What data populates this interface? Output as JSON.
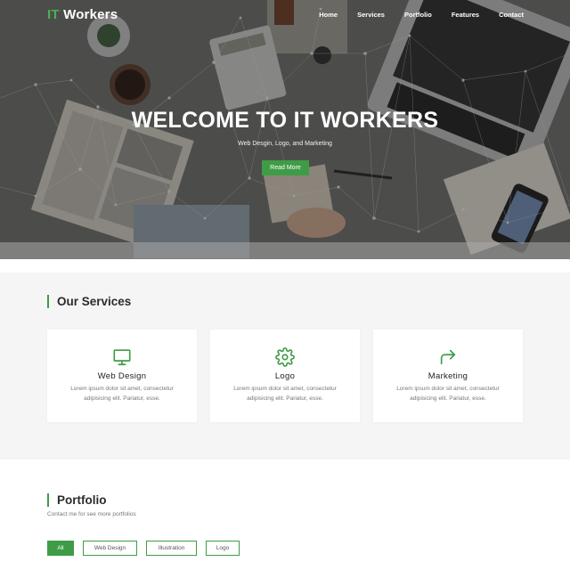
{
  "brand": {
    "logo_accent": "IT",
    "logo_rest": " Workers"
  },
  "nav": {
    "items": [
      "Home",
      "Services",
      "Portfolio",
      "Features",
      "Contact"
    ]
  },
  "hero": {
    "title": "WELCOME TO IT WORKERS",
    "subtitle": "Web Desgin, Logo, and Marketing",
    "button": "Read More"
  },
  "services": {
    "title": "Our Services",
    "cards": [
      {
        "icon": "monitor-icon",
        "title": "Web Design",
        "text": "Lorem ipsum dolor sit amet, consectetur adipisicing elit. Pariatur, esse."
      },
      {
        "icon": "gear-icon",
        "title": "Logo",
        "text": "Lorem ipsum dolor sit amet, consectetur adipisicing elit. Pariatur, esse."
      },
      {
        "icon": "share-arrow-icon",
        "title": "Marketing",
        "text": "Lorem ipsum dolor sit amet, consectetur adipisicing elit. Pariatur, esse."
      }
    ]
  },
  "portfolio": {
    "title": "Portfolio",
    "subtitle": "Contact me for see more portfolios",
    "filters": [
      "All",
      "Web Design",
      "Illustration",
      "Logo"
    ],
    "active_filter": "All"
  },
  "colors": {
    "accent": "#3f9c46",
    "section_bg": "#f5f5f5",
    "text_dark": "#2b2b2b"
  }
}
